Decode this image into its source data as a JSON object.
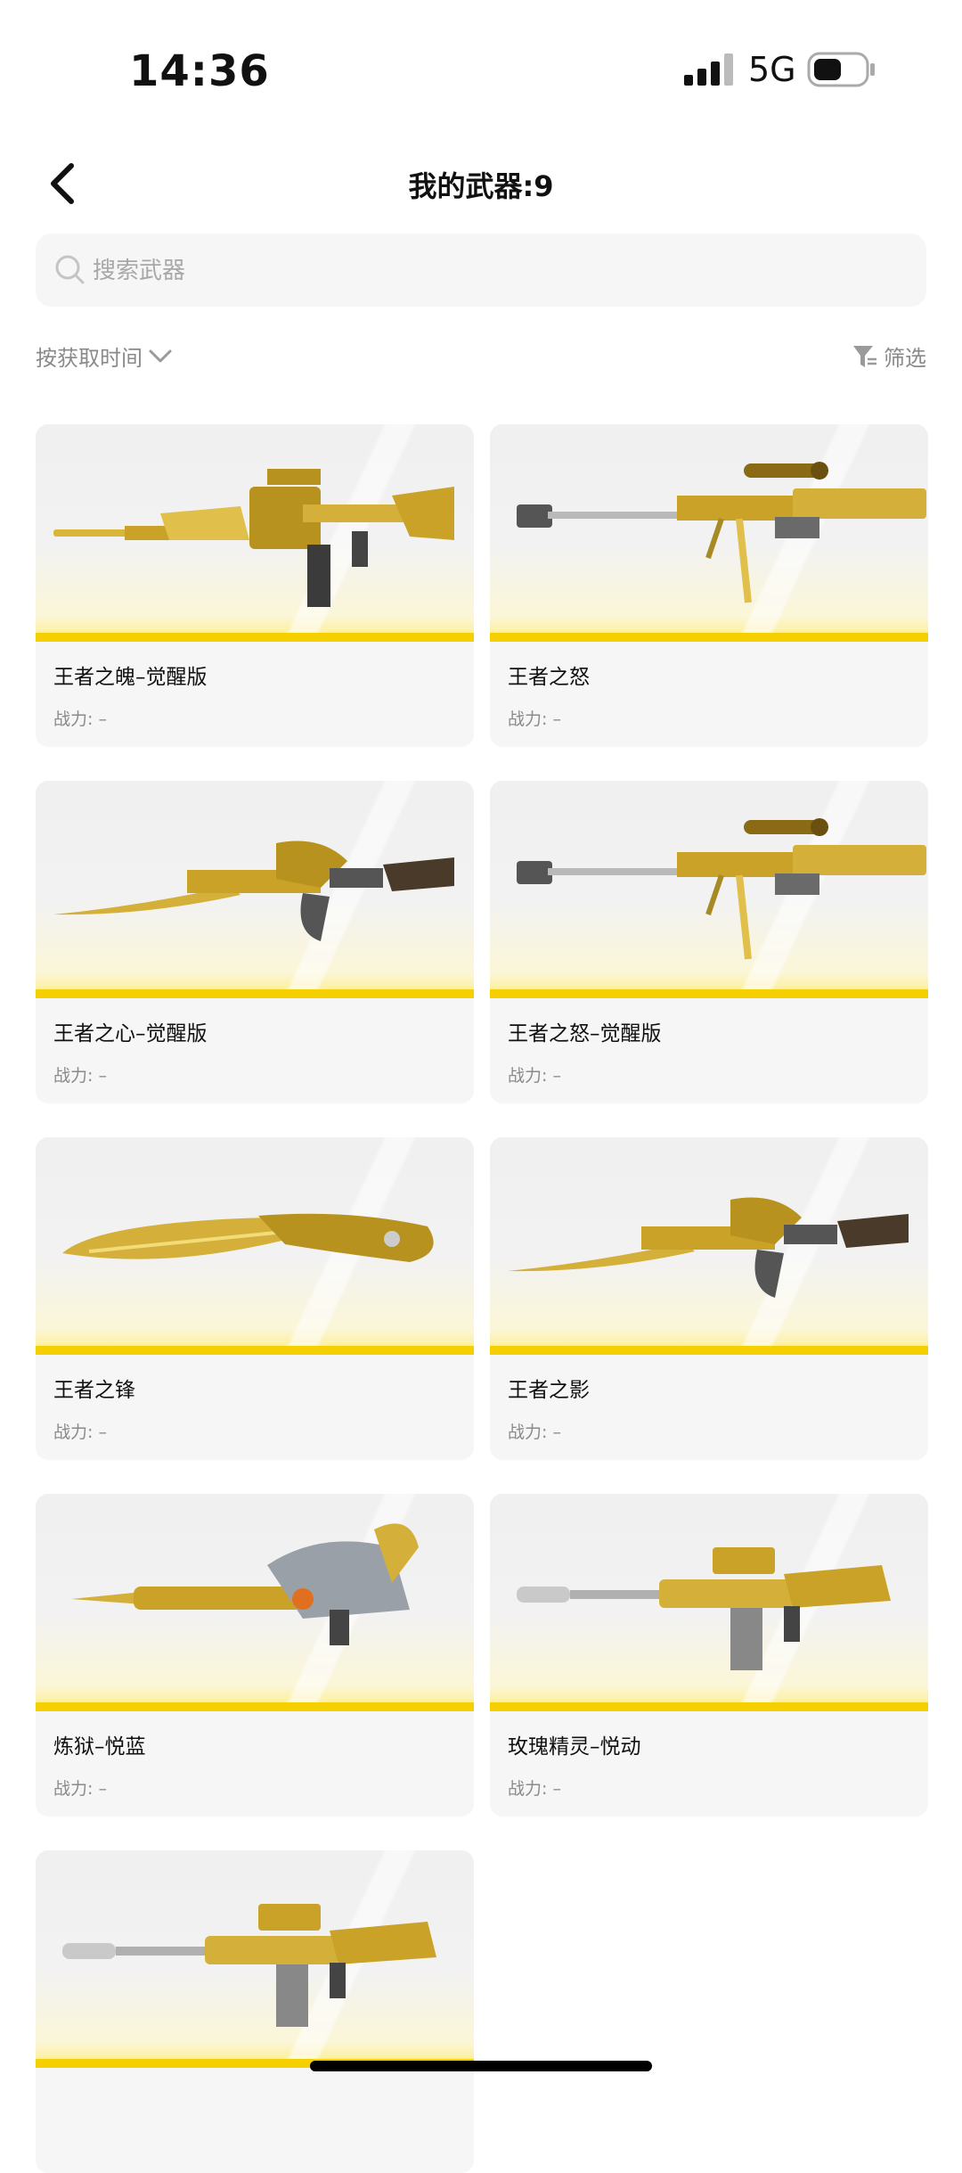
{
  "status_bar": {
    "time": "14:36",
    "network": "5G"
  },
  "header": {
    "title": "我的武器:9"
  },
  "search": {
    "placeholder": "搜索武器",
    "value": ""
  },
  "sort": {
    "label": "按获取时间"
  },
  "filter": {
    "label": "筛选"
  },
  "power_label": "战力: –",
  "weapons": [
    {
      "name": "王者之魄–觉醒版",
      "power": "战力: –",
      "type": "rifle"
    },
    {
      "name": "王者之怒",
      "power": "战力: –",
      "type": "sniper"
    },
    {
      "name": "王者之心–觉醒版",
      "power": "战力: –",
      "type": "ak-blade"
    },
    {
      "name": "王者之怒–觉醒版",
      "power": "战力: –",
      "type": "sniper"
    },
    {
      "name": "王者之锋",
      "power": "战力: –",
      "type": "knife"
    },
    {
      "name": "王者之影",
      "power": "战力: –",
      "type": "ak-blade"
    },
    {
      "name": "炼狱–悦蓝",
      "power": "战力: –",
      "type": "dragon-gun"
    },
    {
      "name": "玫瑰精灵–悦动",
      "power": "战力: –",
      "type": "m4"
    },
    {
      "name": "",
      "power": "",
      "type": "m4"
    }
  ],
  "colors": {
    "accent": "#f6cf00",
    "gold": "#c9a227",
    "muted": "#8a8a8a",
    "card_bg": "#f6f6f6"
  }
}
